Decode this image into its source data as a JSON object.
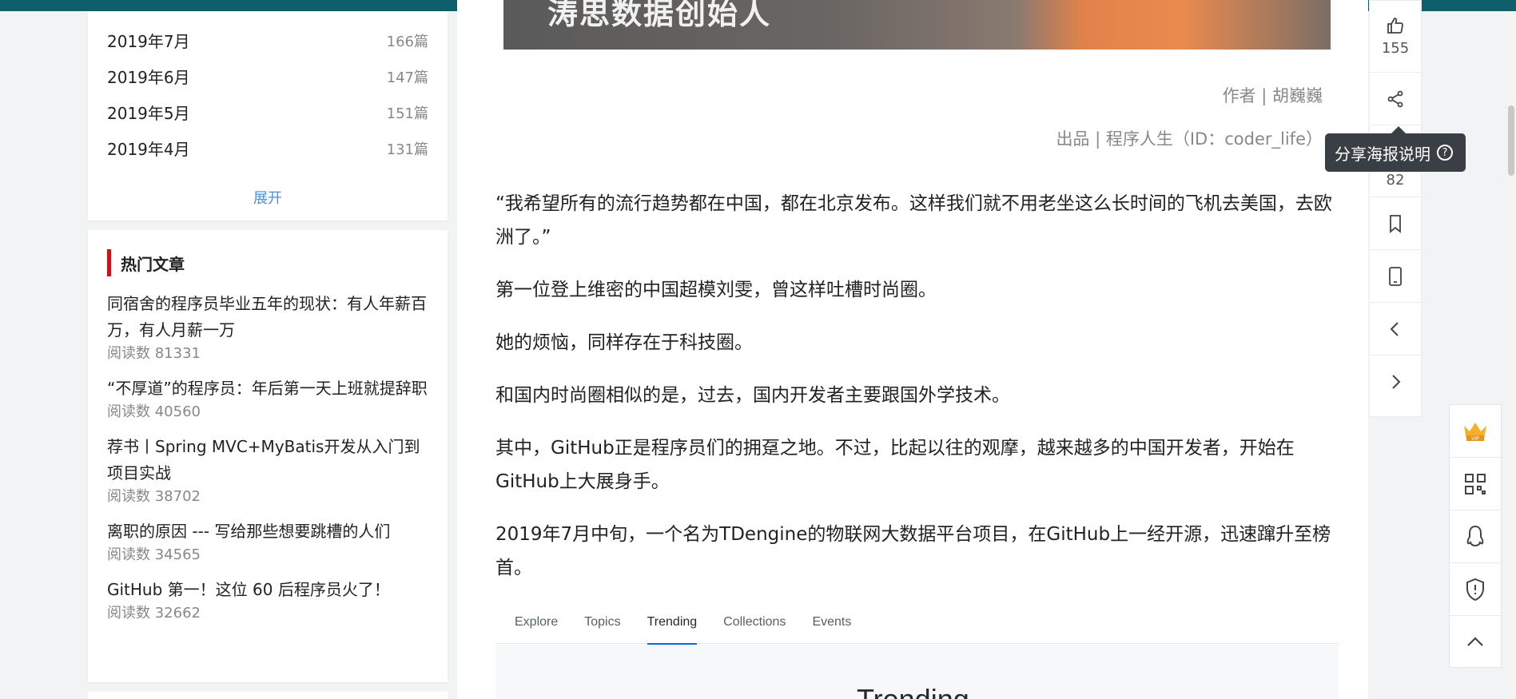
{
  "sidebar": {
    "archive": [
      {
        "month": "2019年7月",
        "count": "166篇"
      },
      {
        "month": "2019年6月",
        "count": "147篇"
      },
      {
        "month": "2019年5月",
        "count": "151篇"
      },
      {
        "month": "2019年4月",
        "count": "131篇"
      }
    ],
    "expand_label": "展开",
    "hot_title": "热门文章",
    "hot_articles": [
      {
        "title": "同宿舍的程序员毕业五年的现状：有人年薪百万，有人月薪一万",
        "reads": "阅读数 81331"
      },
      {
        "title": "“不厚道”的程序员：年后第一天上班就提辞职",
        "reads": "阅读数 40560"
      },
      {
        "title": "荐书丨Spring MVC+MyBatis开发从入门到项目实战",
        "reads": "阅读数 38702"
      },
      {
        "title": "离职的原因 --- 写给那些想要跳槽的人们",
        "reads": "阅读数 34565"
      },
      {
        "title": "GitHub 第一！这位 60 后程序员火了！",
        "reads": "阅读数 32662"
      }
    ]
  },
  "article": {
    "hero_text": "涛思数据创始人",
    "author": "作者 | 胡巍巍",
    "source": "出品 | 程序人生（ID：coder_life）",
    "paragraphs": [
      "“我希望所有的流行趋势都在中国，都在北京发布。这样我们就不用老坐这么长时间的飞机去美国，去欧洲了。”",
      "第一位登上维密的中国超模刘雯，曾这样吐槽时尚圈。",
      "她的烦恼，同样存在于科技圈。",
      "和国内时尚圈相似的是，过去，国内开发者主要跟国外学技术。",
      "其中，GitHub正是程序员们的拥趸之地。不过，比起以往的观摩，越来越多的中国开发者，开始在GitHub上大展身手。",
      "2019年7月中旬，一个名为TDengine的物联网大数据平台项目，在GitHub上一经开源，迅速蹿升至榜首。"
    ],
    "github_tabs": [
      "Explore",
      "Topics",
      "Trending",
      "Collections",
      "Events"
    ],
    "github_heading": "Trending"
  },
  "actions": {
    "like_count": "155",
    "comment_count": "82",
    "tooltip": "分享海报说明"
  },
  "colors": {
    "accent_red": "#c9121b",
    "link_blue": "#4b8fdc",
    "top_strip": "#0e5f6b"
  }
}
